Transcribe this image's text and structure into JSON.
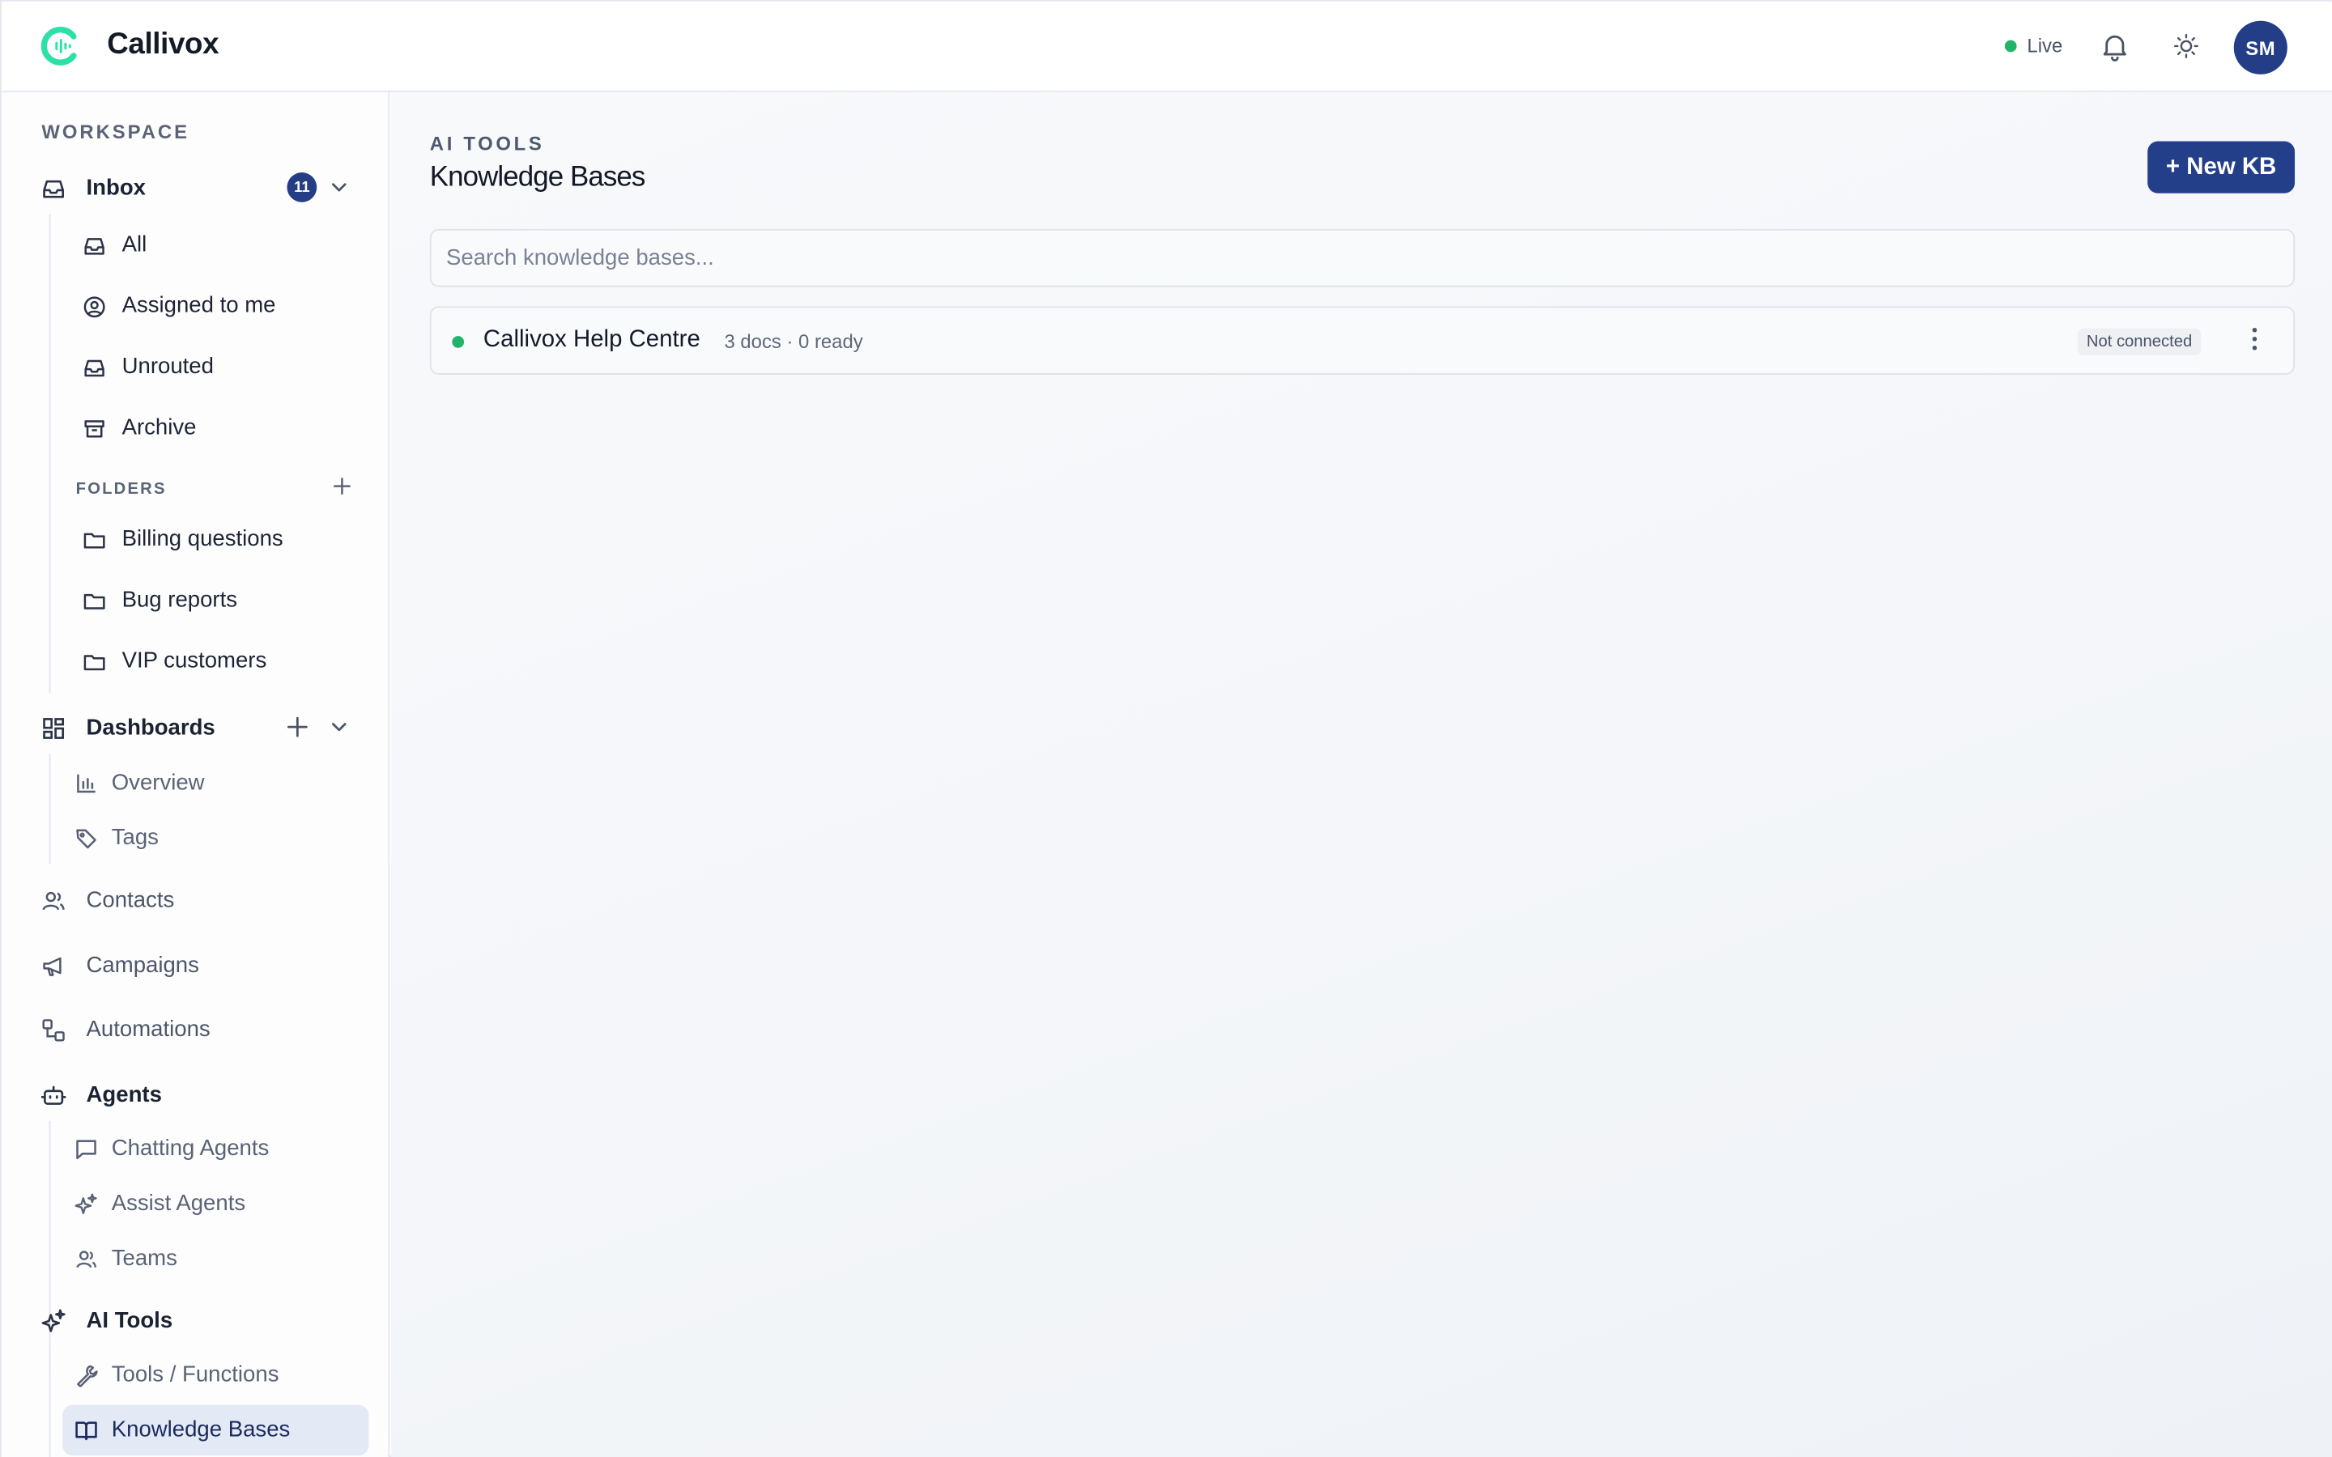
{
  "app": {
    "name": "Callivox",
    "status_label": "Live",
    "user_initials": "SM"
  },
  "colors": {
    "accent": "#243f8a",
    "live": "#22b36b",
    "logo": "#2ee0a8"
  },
  "sidebar": {
    "section_title": "WORKSPACE",
    "inbox": {
      "label": "Inbox",
      "badge": "11",
      "items": [
        {
          "label": "All",
          "icon": "inbox-icon"
        },
        {
          "label": "Assigned to me",
          "icon": "user-circle-icon"
        },
        {
          "label": "Unrouted",
          "icon": "inbox-icon"
        },
        {
          "label": "Archive",
          "icon": "archive-icon"
        }
      ],
      "folders_label": "FOLDERS",
      "folders": [
        {
          "label": "Billing questions"
        },
        {
          "label": "Bug reports"
        },
        {
          "label": "VIP customers"
        }
      ]
    },
    "dashboards": {
      "label": "Dashboards",
      "items": [
        {
          "label": "Overview",
          "icon": "bar-chart-icon"
        },
        {
          "label": "Tags",
          "icon": "tag-icon"
        }
      ]
    },
    "contacts": "Contacts",
    "campaigns": "Campaigns",
    "automations": "Automations",
    "agents": {
      "label": "Agents",
      "items": [
        {
          "label": "Chatting Agents",
          "icon": "chat-icon"
        },
        {
          "label": "Assist Agents",
          "icon": "sparkle-icon"
        },
        {
          "label": "Teams",
          "icon": "users-icon"
        }
      ]
    },
    "ai_tools": {
      "label": "AI Tools",
      "items": [
        {
          "label": "Tools / Functions",
          "icon": "wrench-icon"
        },
        {
          "label": "Knowledge Bases",
          "icon": "book-icon",
          "active": true
        }
      ]
    }
  },
  "main": {
    "eyebrow": "AI TOOLS",
    "title": "Knowledge Bases",
    "new_button": "+ New KB",
    "search_placeholder": "Search knowledge bases...",
    "knowledge_bases": [
      {
        "name": "Callivox Help Centre",
        "meta": "3 docs · 0 ready",
        "status": "Not connected"
      }
    ]
  }
}
